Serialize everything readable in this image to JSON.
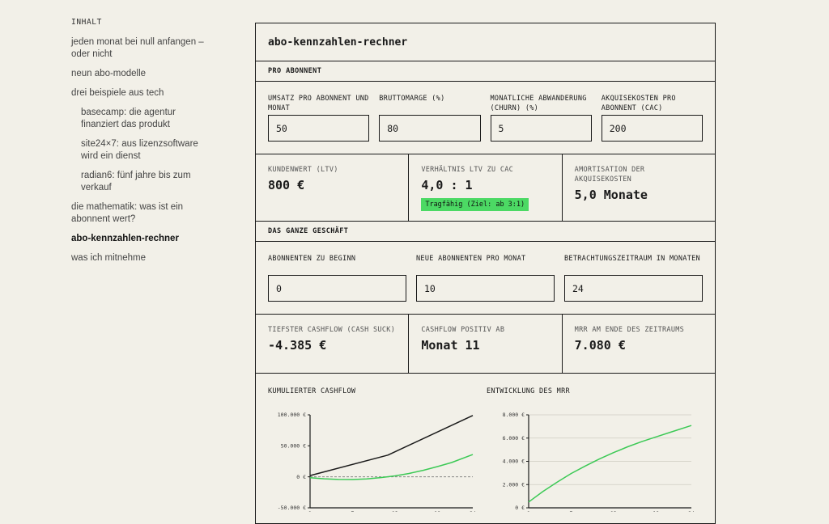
{
  "toc": {
    "heading": "INHALT",
    "items": [
      {
        "label": "jeden monat bei null anfangen – oder nicht",
        "level": 0,
        "active": false
      },
      {
        "label": "neun abo-modelle",
        "level": 0,
        "active": false
      },
      {
        "label": "drei beispiele aus tech",
        "level": 0,
        "active": false
      },
      {
        "label": "basecamp: die agentur finanziert das produkt",
        "level": 1,
        "active": false
      },
      {
        "label": "site24×7: aus lizenzsoftware wird ein dienst",
        "level": 1,
        "active": false
      },
      {
        "label": "radian6: fünf jahre bis zum verkauf",
        "level": 1,
        "active": false
      },
      {
        "label": "die mathematik: was ist ein abonnent wert?",
        "level": 0,
        "active": false
      },
      {
        "label": "abo-kennzahlen-rechner",
        "level": 0,
        "active": true
      },
      {
        "label": "was ich mitnehme",
        "level": 0,
        "active": false
      }
    ]
  },
  "calc": {
    "title": "abo-kennzahlen-rechner",
    "section1": "PRO ABONNENT",
    "inputs1": [
      {
        "label": "UMSATZ PRO ABONNENT UND MONAT",
        "value": "50"
      },
      {
        "label": "BRUTTOMARGE (%)",
        "value": "80"
      },
      {
        "label": "MONATLICHE ABWANDERUNG (CHURN) (%)",
        "value": "5"
      },
      {
        "label": "AKQUISEKOSTEN PRO ABONNENT (CAC)",
        "value": "200"
      }
    ],
    "results1": [
      {
        "label": "KUNDENWERT (LTV)",
        "value": "800 €",
        "badge": ""
      },
      {
        "label": "VERHÄLTNIS LTV ZU CAC",
        "value": "4,0 : 1",
        "badge": "Tragfähig (Ziel: ab 3:1)"
      },
      {
        "label": "AMORTISATION DER AKQUISEKOSTEN",
        "value": "5,0 Monate",
        "badge": ""
      }
    ],
    "section2": "DAS GANZE GESCHÄFT",
    "inputs2": [
      {
        "label": "ABONNENTEN ZU BEGINN",
        "value": "0"
      },
      {
        "label": "NEUE ABONNENTEN PRO MONAT",
        "value": "10"
      },
      {
        "label": "BETRACHTUNGSZEITRAUM IN MONATEN",
        "value": "24"
      }
    ],
    "results2": [
      {
        "label": "TIEFSTER CASHFLOW (CASH SUCK)",
        "value": "-4.385 €"
      },
      {
        "label": "CASHFLOW POSITIV AB",
        "value": "Monat 11"
      },
      {
        "label": "MRR AM ENDE DES ZEITRAUMS",
        "value": "7.080 €"
      }
    ]
  },
  "colors": {
    "accent": "#4cd964",
    "ink": "#1a1a1a",
    "background": "#f2f0e8"
  },
  "chart_data": [
    {
      "type": "line",
      "title": "KUMULIERTER CASHFLOW",
      "xlabel": "",
      "ylabel": "",
      "ylim": [
        -50000,
        100000
      ],
      "yticks": [
        -50000,
        0,
        50000,
        100000
      ],
      "ytick_labels": [
        "-50.000 €",
        "0 €",
        "50.000 €",
        "100.000 €"
      ],
      "xticks": [
        "1",
        "7",
        "13",
        "19",
        "24"
      ],
      "zero_line": true,
      "series": [
        {
          "color": "#1a1a1a",
          "x": [
            1,
            12,
            24
          ],
          "y": [
            2000,
            35000,
            99000
          ]
        },
        {
          "color": "#3cc955",
          "x": [
            1,
            3,
            5,
            7,
            9,
            11,
            13,
            15,
            17,
            19,
            21,
            24
          ],
          "y": [
            -1500,
            -3200,
            -4200,
            -4385,
            -3500,
            -1200,
            1500,
            5500,
            10500,
            16500,
            23000,
            36000
          ]
        }
      ]
    },
    {
      "type": "line",
      "title": "ENTWICKLUNG DES MRR",
      "xlabel": "",
      "ylabel": "",
      "ylim": [
        0,
        8000
      ],
      "yticks": [
        0,
        2000,
        4000,
        6000,
        8000
      ],
      "ytick_labels": [
        "0 €",
        "2.000 €",
        "4.000 €",
        "6.000 €",
        "8.000 €"
      ],
      "xticks": [
        "1",
        "7",
        "13",
        "19",
        "24"
      ],
      "grid": true,
      "series": [
        {
          "color": "#3cc955",
          "x": [
            1,
            3,
            5,
            7,
            9,
            11,
            13,
            15,
            17,
            19,
            21,
            24
          ],
          "y": [
            500,
            1400,
            2200,
            2950,
            3600,
            4200,
            4750,
            5250,
            5700,
            6100,
            6500,
            7080
          ]
        }
      ]
    }
  ]
}
